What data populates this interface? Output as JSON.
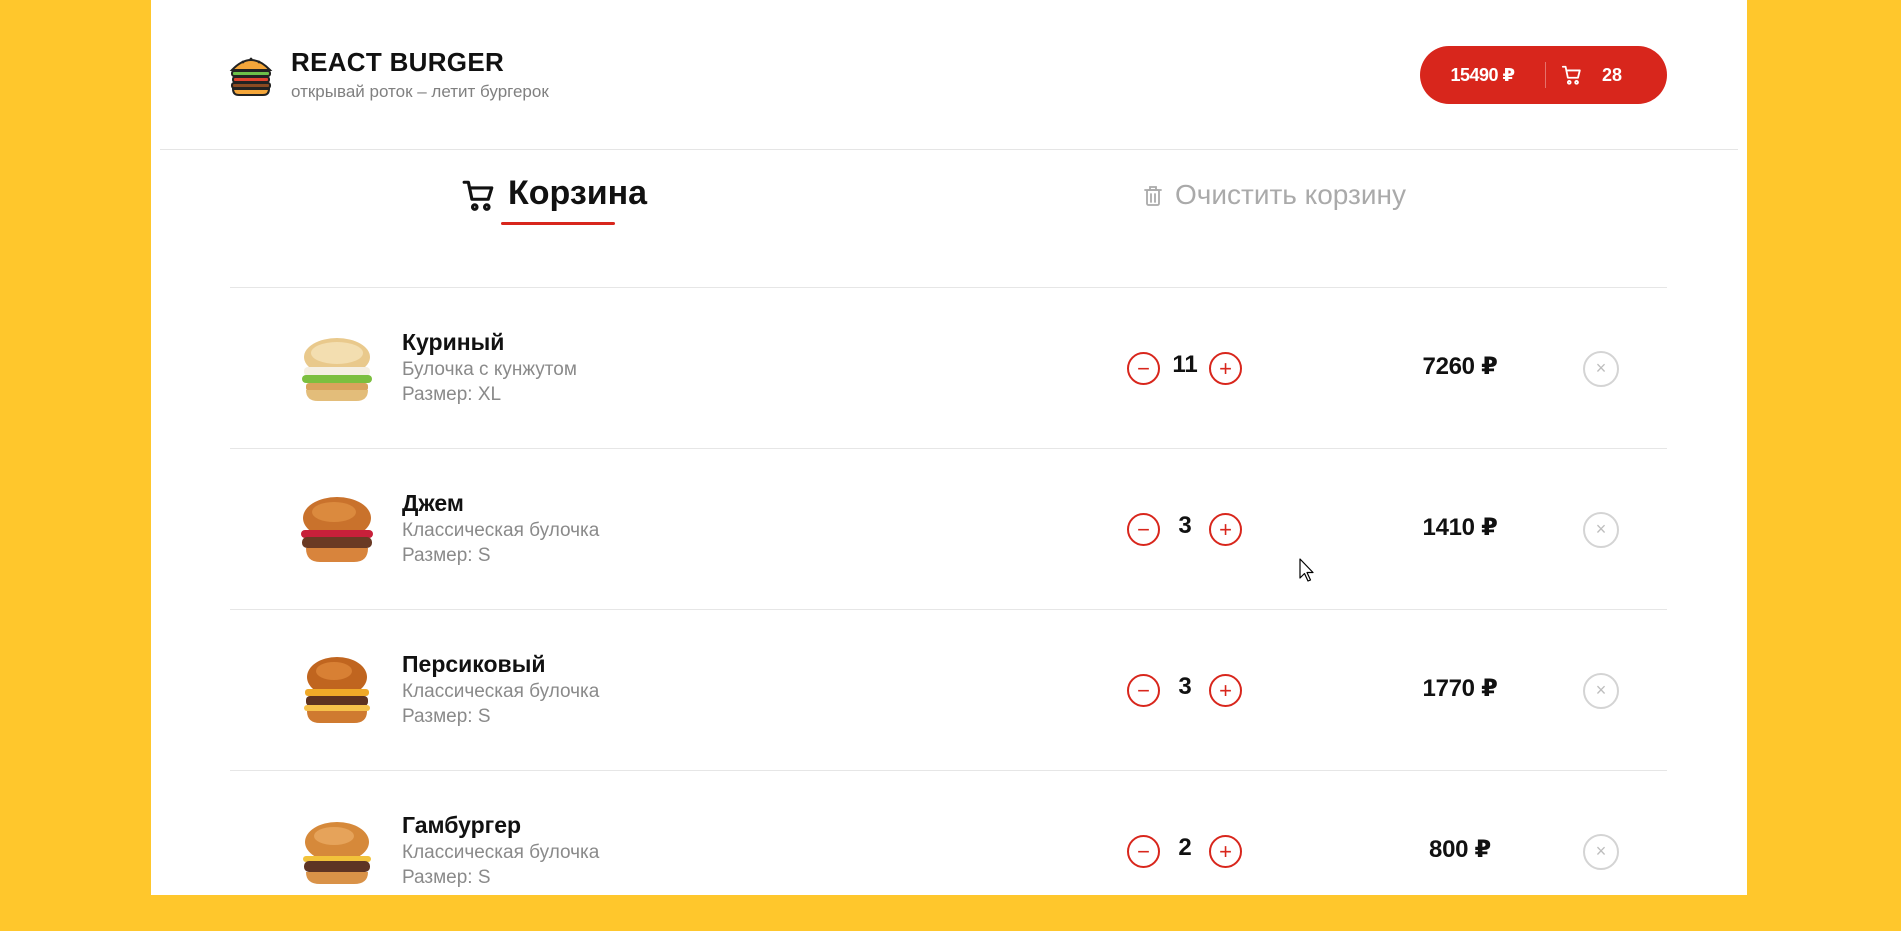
{
  "header": {
    "title": "REACT BURGER",
    "subtitle": "открывай роток – летит бургерок",
    "cart_total": "15490 ₽",
    "cart_count": "28",
    "logo_icon": "burger-logo-icon",
    "cart_icon": "cart-icon"
  },
  "cart": {
    "title": "Корзина",
    "clear_label": "Очистить корзину",
    "accent": "#d8261c"
  },
  "items": [
    {
      "name": "Куриный",
      "bun": "Булочка с кунжутом",
      "size": "Размер: XL",
      "qty": "11",
      "price": "7260 ₽",
      "minus": "−",
      "plus": "+",
      "remove": "×"
    },
    {
      "name": "Джем",
      "bun": "Классическая булочка",
      "size": "Размер: S",
      "qty": "3",
      "price": "1410 ₽",
      "minus": "−",
      "plus": "+",
      "remove": "×"
    },
    {
      "name": "Персиковый",
      "bun": "Классическая булочка",
      "size": "Размер: S",
      "qty": "3",
      "price": "1770 ₽",
      "minus": "−",
      "plus": "+",
      "remove": "×"
    },
    {
      "name": "Гамбургер",
      "bun": "Классическая булочка",
      "size": "Размер: S",
      "qty": "2",
      "price": "800 ₽",
      "minus": "−",
      "plus": "+",
      "remove": "×"
    }
  ]
}
